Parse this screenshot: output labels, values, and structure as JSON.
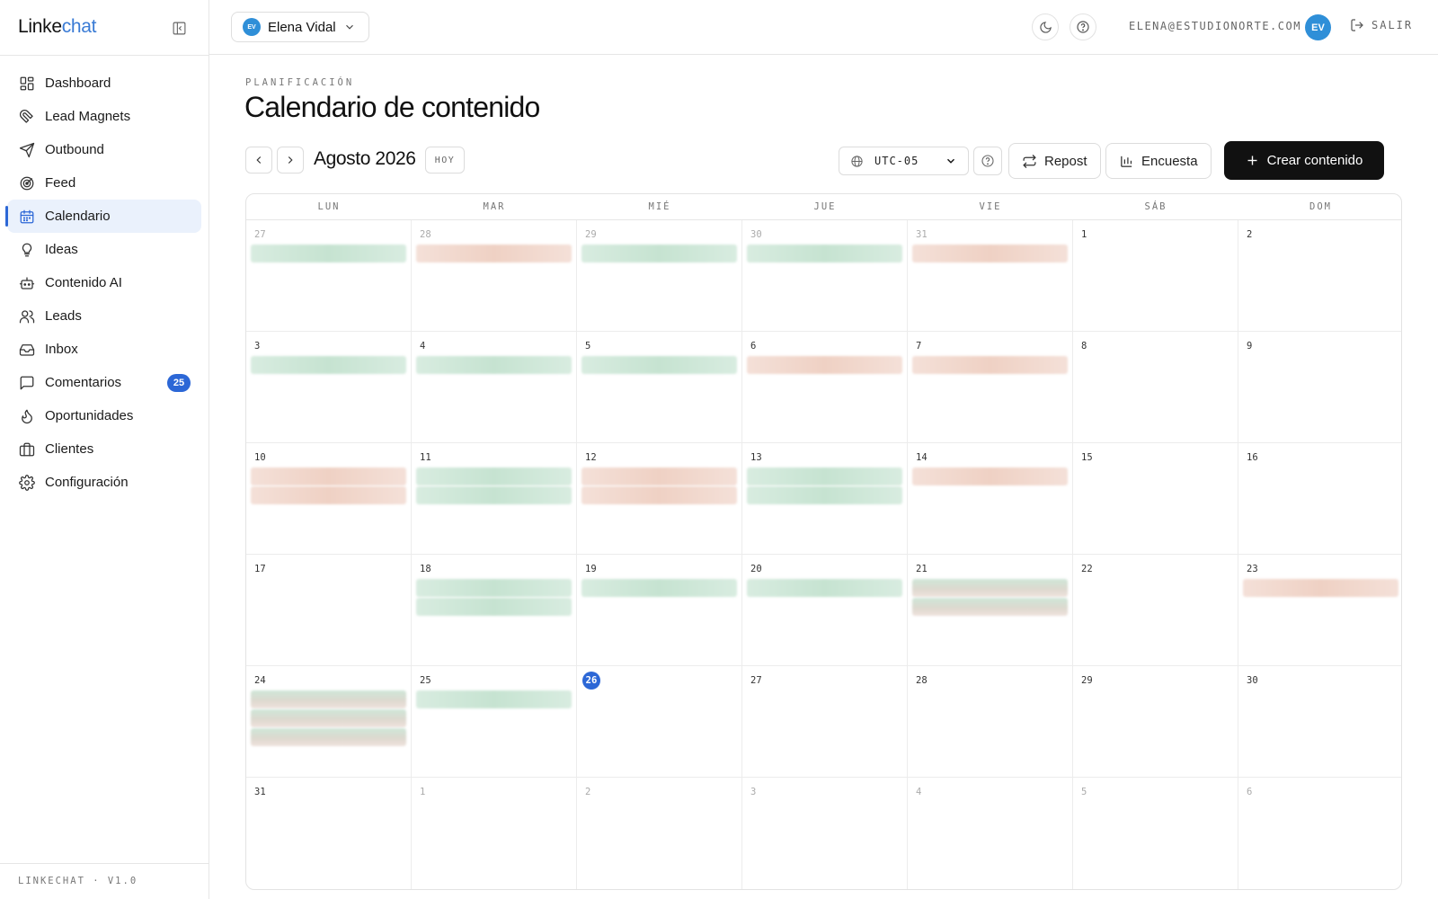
{
  "sidebar": {
    "brand_main": "Linke",
    "brand_accent": "chat",
    "nav": [
      {
        "label": "Dashboard",
        "icon": "dashboard-icon"
      },
      {
        "label": "Lead Magnets",
        "icon": "magnet-icon"
      },
      {
        "label": "Outbound",
        "icon": "send-icon"
      },
      {
        "label": "Feed",
        "icon": "radar-icon"
      },
      {
        "label": "Calendario",
        "icon": "calendar-icon",
        "active": true
      },
      {
        "label": "Ideas",
        "icon": "lightbulb-icon"
      },
      {
        "label": "Contenido AI",
        "icon": "bot-icon"
      },
      {
        "label": "Leads",
        "icon": "users-icon"
      },
      {
        "label": "Inbox",
        "icon": "inbox-icon"
      },
      {
        "label": "Comentarios",
        "icon": "comment-icon",
        "badge": "25"
      },
      {
        "label": "Oportunidades",
        "icon": "flame-icon"
      },
      {
        "label": "Clientes",
        "icon": "briefcase-icon"
      },
      {
        "label": "Configuración",
        "icon": "gear-icon"
      }
    ],
    "footer": "LINKECHAT · V1.0"
  },
  "topbar": {
    "user_initials": "EV",
    "user_name": "Elena Vidal",
    "email": "ELENA@ESTUDIONORTE.COM",
    "logout_label": "SALIR"
  },
  "page": {
    "eyebrow": "PLANIFICACIÓN",
    "title": "Calendario de contenido"
  },
  "toolbar": {
    "month": "Agosto 2026",
    "today_label": "HOY",
    "timezone": "UTC-05",
    "repost_label": "Repost",
    "poll_label": "Encuesta",
    "create_label": "Crear contenido"
  },
  "calendar": {
    "weekdays": [
      "LUN",
      "MAR",
      "MIÉ",
      "JUE",
      "VIE",
      "SÁB",
      "DOM"
    ],
    "today": "26",
    "weeks": [
      [
        {
          "day": "27",
          "muted": true,
          "events": [
            "green"
          ]
        },
        {
          "day": "28",
          "muted": true,
          "events": [
            "peach"
          ]
        },
        {
          "day": "29",
          "muted": true,
          "events": [
            "green"
          ]
        },
        {
          "day": "30",
          "muted": true,
          "events": [
            "green"
          ]
        },
        {
          "day": "31",
          "muted": true,
          "events": [
            "peach"
          ]
        },
        {
          "day": "1",
          "events": []
        },
        {
          "day": "2",
          "events": []
        }
      ],
      [
        {
          "day": "3",
          "events": [
            "green"
          ]
        },
        {
          "day": "4",
          "events": [
            "green"
          ]
        },
        {
          "day": "5",
          "events": [
            "green"
          ]
        },
        {
          "day": "6",
          "events": [
            "peach"
          ]
        },
        {
          "day": "7",
          "events": [
            "peach"
          ]
        },
        {
          "day": "8",
          "events": []
        },
        {
          "day": "9",
          "events": []
        }
      ],
      [
        {
          "day": "10",
          "events": [
            "peach",
            "peach"
          ]
        },
        {
          "day": "11",
          "events": [
            "green",
            "green"
          ]
        },
        {
          "day": "12",
          "events": [
            "peach",
            "peach"
          ]
        },
        {
          "day": "13",
          "events": [
            "green",
            "green"
          ]
        },
        {
          "day": "14",
          "events": [
            "peach"
          ]
        },
        {
          "day": "15",
          "events": []
        },
        {
          "day": "16",
          "events": []
        }
      ],
      [
        {
          "day": "17",
          "events": []
        },
        {
          "day": "18",
          "events": [
            "green",
            "green"
          ]
        },
        {
          "day": "19",
          "events": [
            "green"
          ]
        },
        {
          "day": "20",
          "events": [
            "green"
          ]
        },
        {
          "day": "21",
          "events": [
            "mixed",
            "mixed"
          ]
        },
        {
          "day": "22",
          "events": []
        },
        {
          "day": "23",
          "events": [
            "peach"
          ]
        }
      ],
      [
        {
          "day": "24",
          "events": [
            "mixed",
            "mixed",
            "mixed"
          ]
        },
        {
          "day": "25",
          "events": [
            "green"
          ]
        },
        {
          "day": "26",
          "events": []
        },
        {
          "day": "27",
          "events": []
        },
        {
          "day": "28",
          "events": []
        },
        {
          "day": "29",
          "events": []
        },
        {
          "day": "30",
          "events": []
        }
      ],
      [
        {
          "day": "31",
          "events": []
        },
        {
          "day": "1",
          "muted": true,
          "events": []
        },
        {
          "day": "2",
          "muted": true,
          "events": []
        },
        {
          "day": "3",
          "muted": true,
          "events": []
        },
        {
          "day": "4",
          "muted": true,
          "events": []
        },
        {
          "day": "5",
          "muted": true,
          "events": []
        },
        {
          "day": "6",
          "muted": true,
          "events": []
        }
      ]
    ]
  },
  "colors": {
    "accent": "#2c67d6",
    "brand_accent": "#3a7bd5",
    "event_green": "#c6e3d1",
    "event_peach": "#efd1c4",
    "primary_button": "#111111"
  }
}
